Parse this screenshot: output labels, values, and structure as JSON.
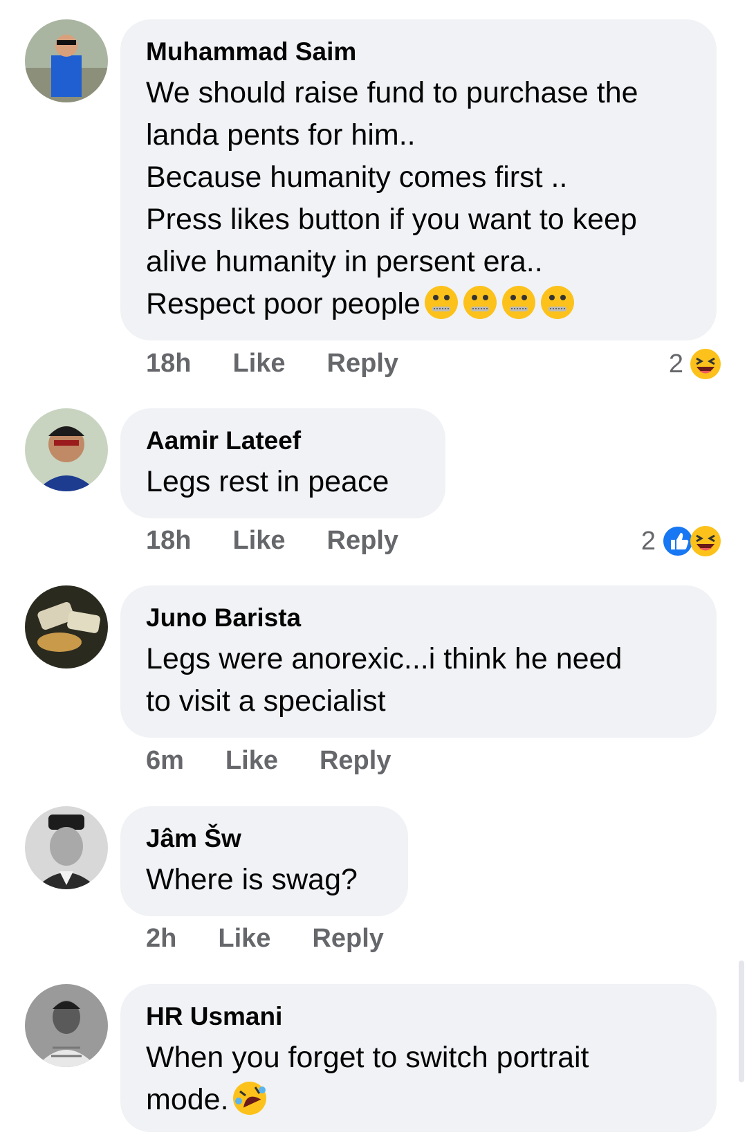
{
  "comments": [
    {
      "name": "Muhammad Saim",
      "text": "We should raise fund to purchase the\nlanda pents for him..\nBecause humanity comes first ..\nPress likes button if you want to keep\nalive humanity in persent era..\nRespect poor people",
      "emoji_suffix": [
        "zipper-mouth-face",
        "zipper-mouth-face",
        "zipper-mouth-face",
        "zipper-mouth-face"
      ],
      "time": "18h",
      "like": "Like",
      "reply": "Reply",
      "reaction_count": "2",
      "reactions": [
        "laughing-face"
      ]
    },
    {
      "name": "Aamir Lateef",
      "text": "Legs rest in peace",
      "time": "18h",
      "like": "Like",
      "reply": "Reply",
      "reaction_count": "2",
      "reactions": [
        "like-thumb",
        "laughing-face"
      ]
    },
    {
      "name": "Juno Barista",
      "text": "Legs were anorexic...i think he need\nto visit a specialist",
      "time": "6m",
      "like": "Like",
      "reply": "Reply"
    },
    {
      "name": "Jâm Šw",
      "text": "Where is swag?",
      "time": "2h",
      "like": "Like",
      "reply": "Reply"
    },
    {
      "name": "HR Usmani",
      "text": "When you forget to switch portrait\nmode.",
      "emoji_suffix": [
        "rolling-on-floor-laughing"
      ]
    }
  ],
  "colors": {
    "bubble": "#f0f2f5",
    "meta": "#65676b",
    "like_blue": "#1877f2",
    "emoji_yellow": "#fcc21b"
  }
}
